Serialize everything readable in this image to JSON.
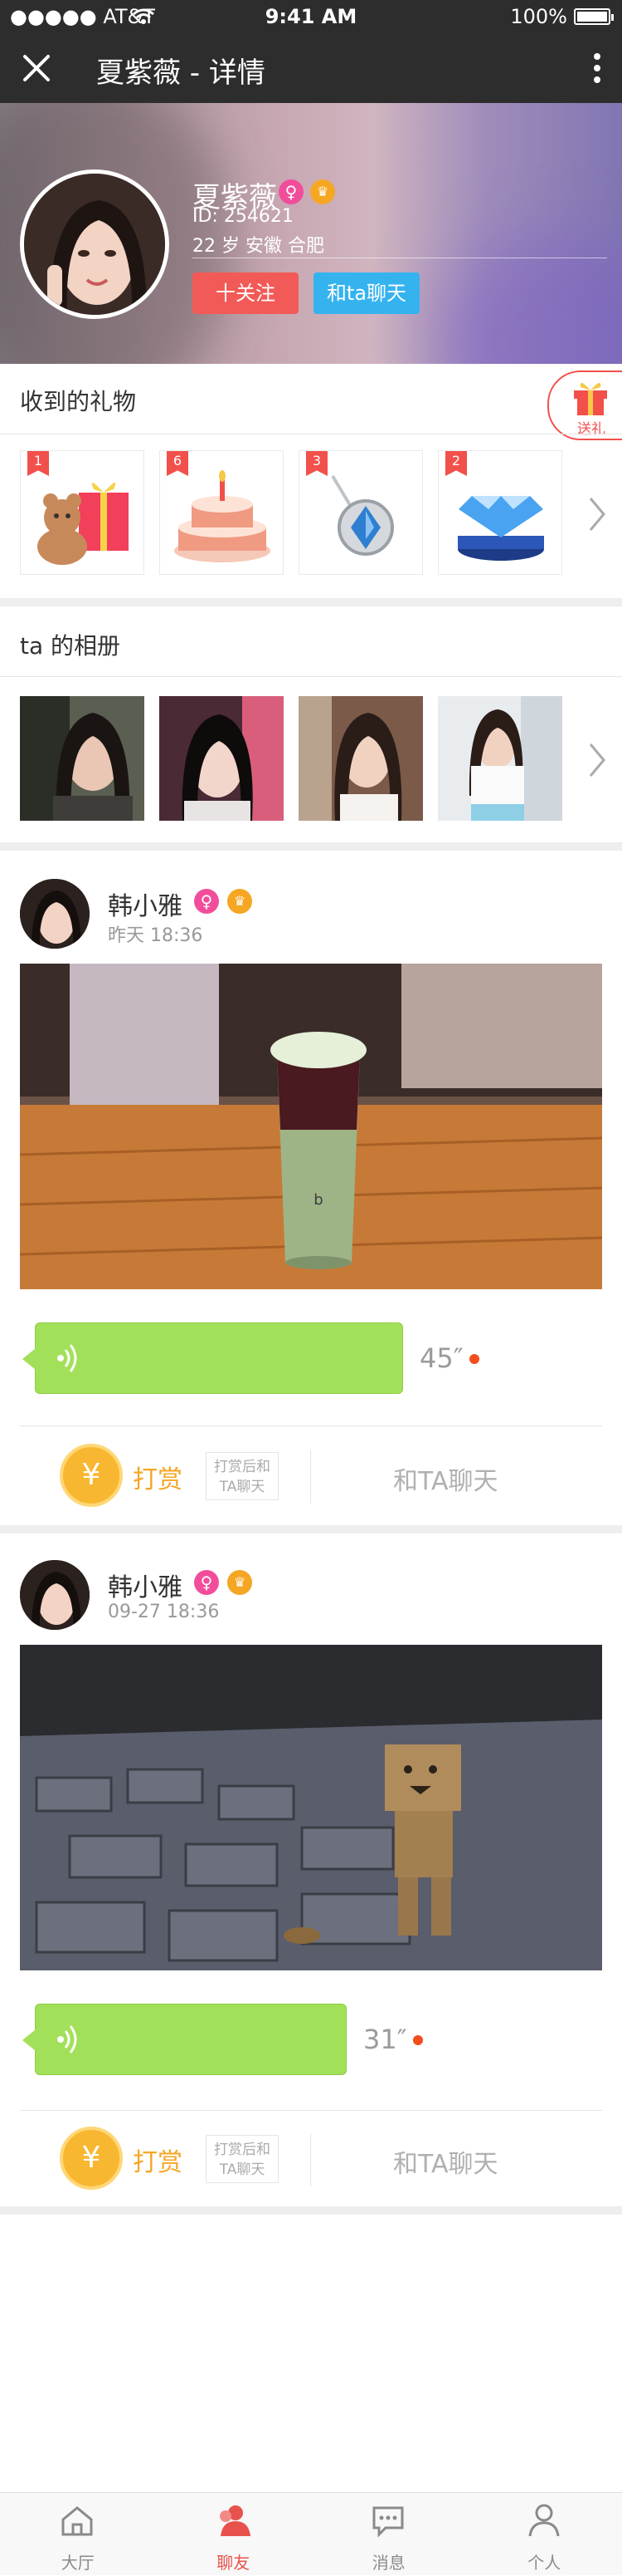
{
  "status_bar": {
    "carrier": "●●●●● AT&T",
    "time": "9:41 AM",
    "battery": "100%"
  },
  "nav": {
    "title": "夏紫薇 - 详情"
  },
  "profile": {
    "name": "夏紫薇",
    "gender_symbol": "♀",
    "vip_symbol": "♛",
    "id_text": "ID:  254621",
    "info_text": "22 岁  安徽 合肥",
    "follow_label": "十关注",
    "chat_label": "和ta聊天"
  },
  "gifts": {
    "title": "收到的礼物",
    "send_label": "送礼",
    "items": [
      {
        "count": "1",
        "name": "teddy-bear-gift"
      },
      {
        "count": "6",
        "name": "birthday-cake"
      },
      {
        "count": "3",
        "name": "diamond-necklace"
      },
      {
        "count": "2",
        "name": "diamond"
      }
    ]
  },
  "album": {
    "title": "ta 的相册",
    "photos": 4
  },
  "posts": [
    {
      "name": "韩小雅",
      "gender_symbol": "♀",
      "vip_symbol": "♛",
      "time": "昨天 18:36",
      "duration": "45″",
      "tip_symbol": "¥",
      "tip_label": "打赏",
      "tip_note_1": "打赏后和",
      "tip_note_2": "TA聊天",
      "chat_label": "和TA聊天"
    },
    {
      "name": "韩小雅",
      "gender_symbol": "♀",
      "vip_symbol": "♛",
      "time": "09-27 18:36",
      "duration": "31″",
      "tip_symbol": "¥",
      "tip_label": "打赏",
      "tip_note_1": "打赏后和",
      "tip_note_2": "TA聊天",
      "chat_label": "和TA聊天"
    }
  ],
  "tabs": [
    {
      "label": "大厅",
      "active": false
    },
    {
      "label": "聊友",
      "active": true
    },
    {
      "label": "消息",
      "active": false
    },
    {
      "label": "个人",
      "active": false
    }
  ],
  "colors": {
    "accent_red": "#f25a57",
    "accent_blue": "#35b3ef",
    "voice_green": "#a3e05a",
    "tip_orange": "#f5a623"
  }
}
